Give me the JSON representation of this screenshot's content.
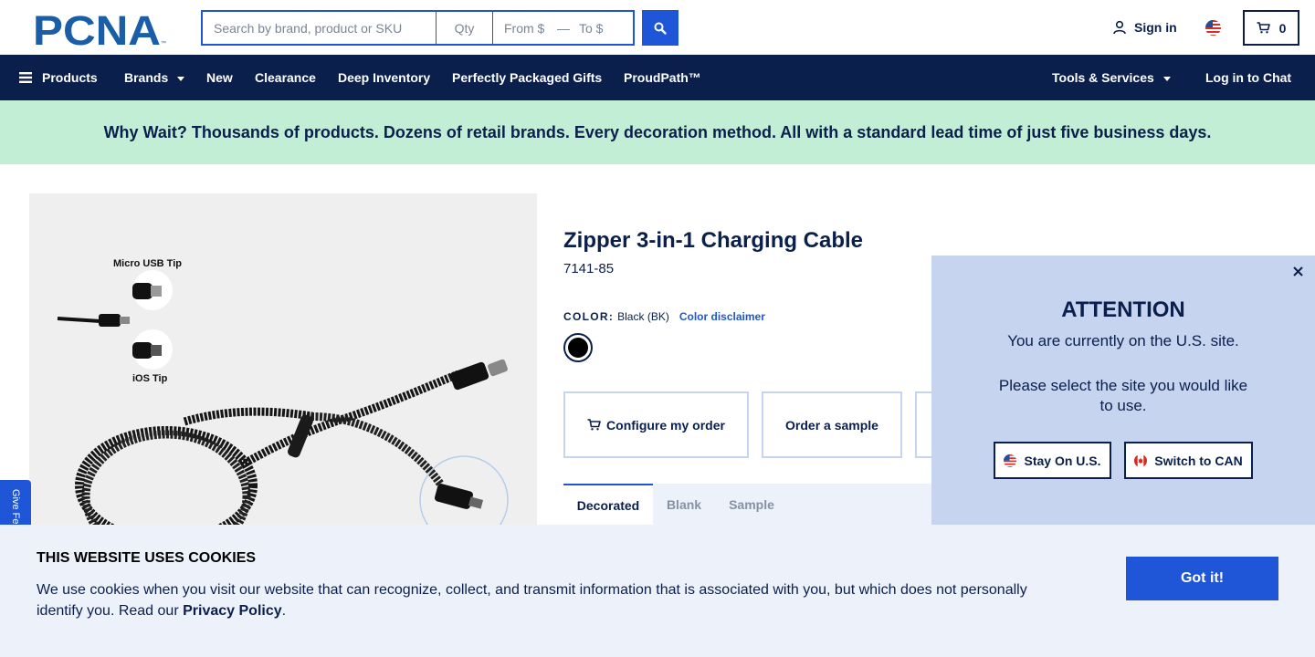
{
  "header": {
    "logo_text": "PCNA",
    "search_placeholder": "Search by brand, product or SKU",
    "qty_placeholder": "Qty",
    "from_placeholder": "From $",
    "price_dash": "—",
    "to_placeholder": "To $",
    "search_icon": "magnifier-icon",
    "signin_label": "Sign in",
    "signin_icon": "user-icon",
    "region_flag": "us-flag-icon",
    "cart_count": "0",
    "cart_icon": "cart-icon"
  },
  "nav": {
    "products": "Products",
    "brands": "Brands",
    "new": "New",
    "clearance": "Clearance",
    "deep_inventory": "Deep Inventory",
    "gifts": "Perfectly Packaged Gifts",
    "proudpath": "ProudPath™",
    "tools": "Tools & Services",
    "chat": "Log in to Chat"
  },
  "promo": "Why Wait? Thousands of products. Dozens of retail brands. Every decoration method. All with a standard lead time of just five business days.",
  "product_image": {
    "micro_label": "Micro USB Tip",
    "ios_label": "iOS Tip"
  },
  "feedback_tab": "Give Feedback",
  "product": {
    "title": "Zipper 3-in-1 Charging Cable",
    "sku": "7141-85",
    "color_label": "COLOR:",
    "color_value": "Black (BK)",
    "color_disclaimer": "Color disclaimer",
    "swatch_color": "#000000",
    "configure_label": "Configure my order",
    "sample_label": "Order a sample",
    "tabs": [
      "Decorated",
      "Blank",
      "Sample"
    ]
  },
  "attention": {
    "title": "ATTENTION",
    "message1": "You are currently on the U.S. site.",
    "message2": "Please select the site you would like to use.",
    "stay_label": "Stay On U.S.",
    "switch_label": "Switch to CAN"
  },
  "cookie": {
    "title": "THIS WEBSITE USES COOKIES",
    "text": "We use cookies when you visit our website that can recognize, collect, and transmit information that is associated with you, but which does not personally identify you. Read our",
    "link": "Privacy Policy",
    "period": ".",
    "button": "Got it!"
  },
  "colors": {
    "navy": "#0b1f4d",
    "accent_blue": "#1f56d8",
    "promo_green": "#c2eed5",
    "modal_blue": "#c6d4ef",
    "cookie_bg": "#edf2fa"
  }
}
